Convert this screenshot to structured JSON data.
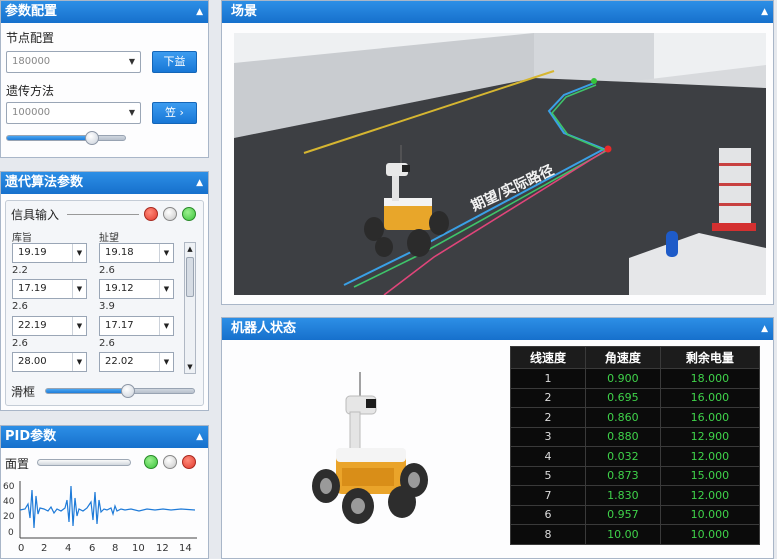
{
  "params_panel": {
    "title": "参数配置",
    "node_label": "节点配置",
    "node_value": "180000",
    "node_button": "下益",
    "method_label": "遗传方法",
    "method_value": "100000",
    "method_button": "笠 ›",
    "slider_level": 0.72
  },
  "iter_panel": {
    "title": "遗代算法参数",
    "signal_label": "信具输入",
    "col1_header": "库旨",
    "col2_header": "扯望",
    "rows": [
      {
        "left_label": "",
        "left": "19.19",
        "right_label": "",
        "right": "19.18"
      },
      {
        "left_label": "2.2",
        "left": "17.19",
        "right_label": "2.6",
        "right": "19.12"
      },
      {
        "left_label": "2.6",
        "left": "22.19",
        "right_label": "3.9",
        "right": "17.17"
      },
      {
        "left_label": "2.6",
        "left": "28.00",
        "right_label": "2.6",
        "right": "22.02"
      }
    ],
    "slider_label": "滑框",
    "slider_level": 0.55
  },
  "pid_panel": {
    "title": "PID参数",
    "label": "面置",
    "y_ticks": [
      "60",
      "40",
      "20",
      "0"
    ],
    "x_ticks": [
      "0",
      "2",
      "4",
      "6",
      "8",
      "10",
      "12",
      "14"
    ]
  },
  "scene_panel": {
    "title": "场景",
    "overlay_text": "期望/实际路径"
  },
  "robot_panel": {
    "title": "机器人状态",
    "table_headers": [
      "线速度",
      "角速度",
      "剩余电量"
    ],
    "table_rows": [
      [
        "1",
        "0.900",
        "18.000"
      ],
      [
        "2",
        "0.695",
        "16.000"
      ],
      [
        "2",
        "0.860",
        "16.000"
      ],
      [
        "3",
        "0.880",
        "12.900"
      ],
      [
        "4",
        "0.032",
        "12.000"
      ],
      [
        "5",
        "0.873",
        "15.000"
      ],
      [
        "7",
        "1.830",
        "12.000"
      ],
      [
        "6",
        "0.957",
        "10.000"
      ],
      [
        "8",
        "10.00",
        "10.000"
      ]
    ]
  },
  "colors": {
    "header_blue": "#1670cc",
    "status_red": "#e23b2e",
    "status_green": "#3bc43b",
    "table_green": "#3fd24a"
  }
}
